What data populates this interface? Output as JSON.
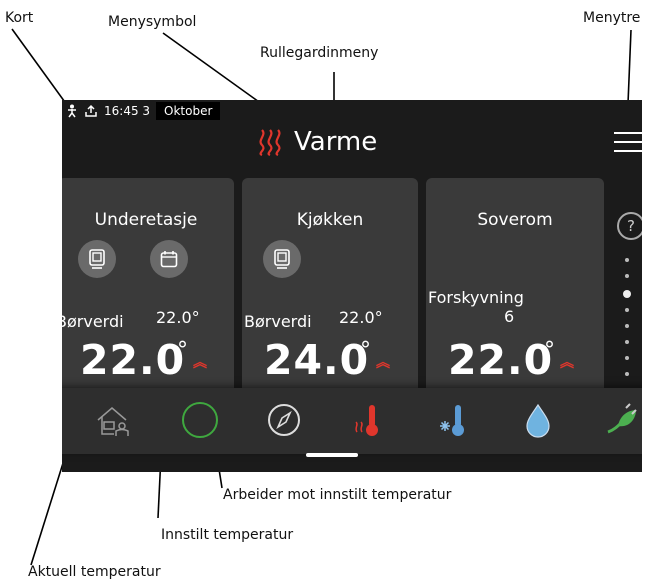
{
  "callouts": {
    "kort": "Kort",
    "menysymbol": "Menysymbol",
    "rullegardinmeny": "Rullegardinmeny",
    "menytre": "Menytre",
    "arbeider": "Arbeider mot innstilt temperatur",
    "innstilt": "Innstilt temperatur",
    "aktuell": "Aktuell temperatur"
  },
  "status_bar": {
    "time": "16:45 3",
    "month": "Oktober"
  },
  "header": {
    "title": "Varme",
    "icon": "heat-waves-icon",
    "accent": "#e0362c"
  },
  "cards": [
    {
      "name": "Underetasje",
      "setpoint_label": "Børverdi",
      "setpoint": "22.0°",
      "current": "22.0",
      "unit": "°",
      "buttons": [
        "room-sensor-icon",
        "calendar-icon"
      ]
    },
    {
      "name": "Kjøkken",
      "setpoint_label": "Børverdi",
      "setpoint": "22.0°",
      "current": "24.0",
      "unit": "°",
      "buttons": [
        "room-sensor-icon"
      ]
    },
    {
      "name": "Soverom",
      "offset_label": "Forskyvning",
      "offset": "6",
      "current": "22.0",
      "unit": "°"
    }
  ],
  "help": "?",
  "bottom_nav": [
    "indoor-climate-icon",
    "status-icon",
    "compass-icon",
    "heating-thermometer-icon",
    "cooling-thermometer-icon",
    "water-drop-icon",
    "plug-leaf-icon"
  ],
  "close": "×"
}
